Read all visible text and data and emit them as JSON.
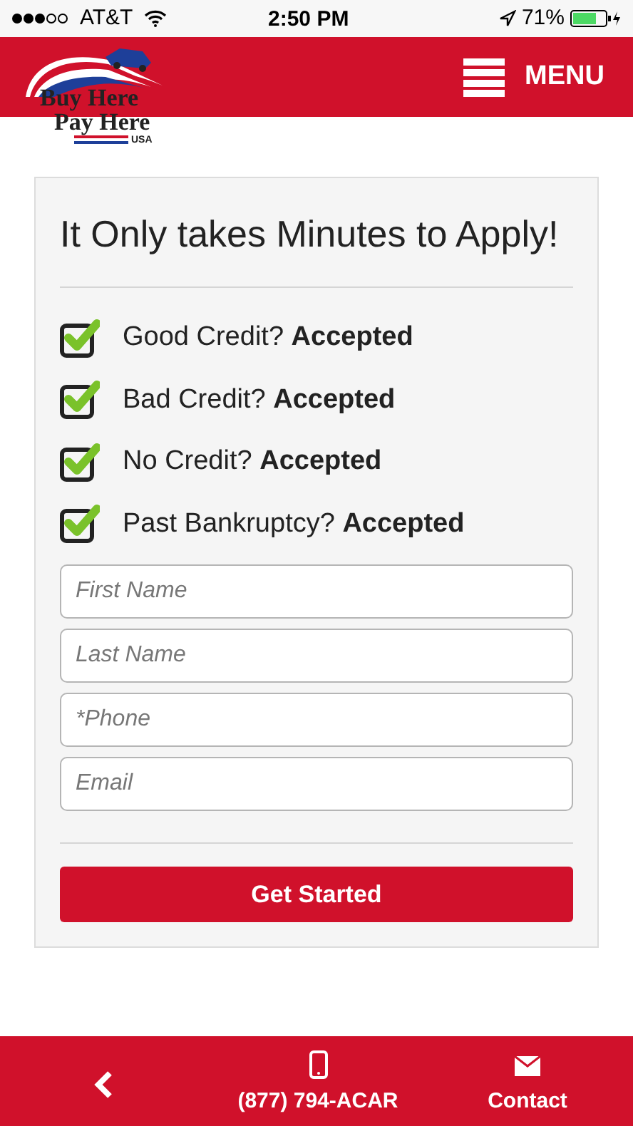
{
  "status_bar": {
    "carrier": "AT&T",
    "time": "2:50 PM",
    "battery": "71%"
  },
  "header": {
    "logo": {
      "line_1": "Buy Here",
      "line_2": "Pay Here",
      "line_3": "USA"
    },
    "menu_label": "MENU"
  },
  "form": {
    "title": "It Only takes Minutes to Apply!",
    "checklist": [
      {
        "text": "Good Credit? **Accepted**",
        "checked": true
      },
      {
        "text": "Bad Credit? **Accepted**",
        "checked": true
      },
      {
        "text": "No Credit? **Accepted**",
        "checked": true
      },
      {
        "text": "Past Bankruptcy? **Accepted**",
        "checked": true
      }
    ],
    "fields": [
      {
        "placeholder": "First Name"
      },
      {
        "placeholder": "Last Name"
      },
      {
        "placeholder": "*Phone"
      },
      {
        "placeholder": "Email"
      }
    ],
    "submit": "Get Started"
  },
  "bottom_bar": {
    "phone": "(877) 794-ACAR",
    "contact": "Contact"
  }
}
